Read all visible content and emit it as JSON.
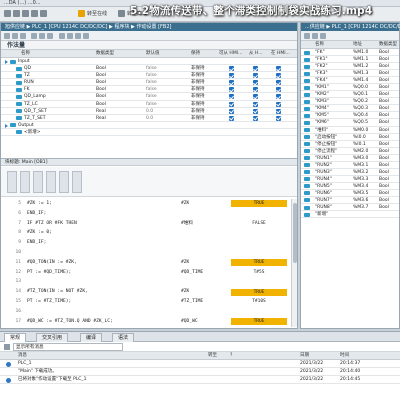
{
  "window": {
    "title_fragment": "...DA (...)  ...0...",
    "video_title": "5.2物流传送带、整个滞类控制制袋实战练习.mp4"
  },
  "toolbar": {
    "items": [
      "转至在线",
      "转至离线",
      "..."
    ]
  },
  "left_breadcrumb": "旭供应链 ▶ PLC_1 [CPU 1214C DC/DC/DC] ▶ 程序块 ▶ 作动设置 [FB2]",
  "right_breadcrumb": "...供应链 ▶ PLC_1 [CPU 1214C DC/DC/DC]",
  "interface": {
    "section_title": "作法量",
    "columns": [
      "名称",
      "数据类型",
      "默认值",
      "保持",
      "可从 HMI...",
      "从 H...",
      "在 HMI..."
    ],
    "rows": [
      {
        "indent": 0,
        "expander": true,
        "name": "Input",
        "type": "",
        "default": "",
        "retain": "",
        "checks": false
      },
      {
        "indent": 1,
        "expander": false,
        "name": "QD",
        "type": "Bool",
        "default": "false",
        "retain": "非保持",
        "checks": true
      },
      {
        "indent": 1,
        "expander": false,
        "name": "TZ",
        "type": "Bool",
        "default": "false",
        "retain": "非保持",
        "checks": true
      },
      {
        "indent": 1,
        "expander": false,
        "name": "RUN",
        "type": "Bool",
        "default": "false",
        "retain": "非保持",
        "checks": true
      },
      {
        "indent": 1,
        "expander": false,
        "name": "FK",
        "type": "Bool",
        "default": "false",
        "retain": "非保持",
        "checks": true
      },
      {
        "indent": 1,
        "expander": false,
        "name": "QD_Lamp",
        "type": "Bool",
        "default": "false",
        "retain": "非保持",
        "checks": true
      },
      {
        "indent": 1,
        "expander": false,
        "name": "TZ_LC",
        "type": "Bool",
        "default": "false",
        "retain": "非保持",
        "checks": true
      },
      {
        "indent": 1,
        "expander": false,
        "name": "QD_T_SET",
        "type": "Real",
        "default": "0.0",
        "retain": "非保持",
        "checks": true
      },
      {
        "indent": 1,
        "expander": false,
        "name": "TZ_T_SET",
        "type": "Real",
        "default": "0.0",
        "retain": "非保持",
        "checks": true
      },
      {
        "indent": 0,
        "expander": true,
        "name": "Output",
        "type": "",
        "default": "",
        "retain": "",
        "checks": false
      },
      {
        "indent": 1,
        "expander": false,
        "name": "<新增>",
        "type": "",
        "default": "",
        "retain": "",
        "checks": false
      }
    ]
  },
  "code_header": "块标题: Main [OB1]",
  "code": {
    "lines": [
      {
        "ln": "5",
        "text": "#ZK := 1;",
        "mon_name": "#ZK",
        "mon_val": "TRUE",
        "state": "true"
      },
      {
        "ln": "6",
        "text": "END_IF;",
        "mon_name": "",
        "mon_val": "",
        "state": ""
      },
      {
        "ln": "7",
        "text": "IF #TZ OR #FK THEN",
        "mon_name": "#堆料",
        "mon_val": "FALSE",
        "state": "false"
      },
      {
        "ln": "8",
        "text": "    #ZK := 0;",
        "mon_name": "",
        "mon_val": "",
        "state": ""
      },
      {
        "ln": "9",
        "text": "END_IF;",
        "mon_name": "",
        "mon_val": "",
        "state": ""
      },
      {
        "ln": "10",
        "text": "",
        "mon_name": "",
        "mon_val": "",
        "state": ""
      },
      {
        "ln": "11",
        "text": "#QD_TON(IN := #ZK,",
        "mon_name": "#ZK",
        "mon_val": "TRUE",
        "state": "true"
      },
      {
        "ln": "12",
        "text": "        PT := #QD_TIME);",
        "mon_name": "#QD_TIME",
        "mon_val": "T#5S",
        "state": "false"
      },
      {
        "ln": "13",
        "text": "",
        "mon_name": "",
        "mon_val": "",
        "state": ""
      },
      {
        "ln": "14",
        "text": "#TZ_TON(IN := NOT #ZK,",
        "mon_name": "#ZK",
        "mon_val": "TRUE",
        "state": "true"
      },
      {
        "ln": "15",
        "text": "        PT := #TZ_TIME);",
        "mon_name": "#TZ_TIME",
        "mon_val": "T#10S",
        "state": "false"
      },
      {
        "ln": "16",
        "text": "",
        "mon_name": "",
        "mon_val": "",
        "state": ""
      },
      {
        "ln": "17",
        "text": "#QD_WC := #TZ_TON.Q AND #ZK_LC;",
        "mon_name": "#QD_WC",
        "mon_val": "TRUE",
        "state": "true"
      },
      {
        "ln": "18",
        "text": "#TZ_WC := #TZ_TON.Q AND #TZ_LC;",
        "mon_name": "#TZ_WC",
        "mon_val": "FALSE",
        "state": "false"
      },
      {
        "ln": "19",
        "text": "",
        "mon_name": "",
        "mon_val": "",
        "state": ""
      },
      {
        "ln": "20",
        "text": "",
        "mon_name": "",
        "mon_val": "",
        "state": ""
      }
    ]
  },
  "tag_table": {
    "columns": [
      "名称",
      "地址",
      "数据类型",
      "注释"
    ],
    "rows": [
      {
        "name": "\"FK\"",
        "addr": "%M1.0",
        "type": "Bool"
      },
      {
        "name": "\"FK1\"",
        "addr": "%M1.1",
        "type": "Bool"
      },
      {
        "name": "\"FK2\"",
        "addr": "%M1.2",
        "type": "Bool"
      },
      {
        "name": "\"FK3\"",
        "addr": "%M1.3",
        "type": "Bool"
      },
      {
        "name": "\"FK4\"",
        "addr": "%M1.4",
        "type": "Bool"
      },
      {
        "name": "\"KM1\"",
        "addr": "%Q0.0",
        "type": "Bool"
      },
      {
        "name": "\"KM2\"",
        "addr": "%Q0.1",
        "type": "Bool"
      },
      {
        "name": "\"KM3\"",
        "addr": "%Q0.2",
        "type": "Bool"
      },
      {
        "name": "\"KM4\"",
        "addr": "%Q0.3",
        "type": "Bool"
      },
      {
        "name": "\"KM5\"",
        "addr": "%Q0.4",
        "type": "Bool"
      },
      {
        "name": "\"KM6\"",
        "addr": "%Q0.5",
        "type": "Bool"
      },
      {
        "name": "\"堆料\"",
        "addr": "%M0.0",
        "type": "Bool"
      },
      {
        "name": "\"启动按钮\"",
        "addr": "%I0.0",
        "type": "Bool"
      },
      {
        "name": "\"停止按钮\"",
        "addr": "%I0.1",
        "type": "Bool"
      },
      {
        "name": "\"停止流程\"",
        "addr": "%M2.0",
        "type": "Bool"
      },
      {
        "name": "\"RUN1\"",
        "addr": "%M3.0",
        "type": "Bool"
      },
      {
        "name": "\"RUN2\"",
        "addr": "%M3.1",
        "type": "Bool"
      },
      {
        "name": "\"RUN3\"",
        "addr": "%M3.2",
        "type": "Bool"
      },
      {
        "name": "\"RUN4\"",
        "addr": "%M3.3",
        "type": "Bool"
      },
      {
        "name": "\"RUN5\"",
        "addr": "%M3.4",
        "type": "Bool"
      },
      {
        "name": "\"RUN6\"",
        "addr": "%M3.5",
        "type": "Bool"
      },
      {
        "name": "\"RUN7\"",
        "addr": "%M3.6",
        "type": "Bool"
      },
      {
        "name": "\"RUN8\"",
        "addr": "%M3.7",
        "type": "Bool"
      },
      {
        "name": "\"新增\"",
        "addr": "",
        "type": ""
      }
    ]
  },
  "inspector": {
    "tabs": [
      "常规",
      "交叉引用",
      "编译",
      "语法"
    ],
    "filter_label": "显示所有消息",
    "columns": [
      "消息",
      "转至",
      "?",
      "日期",
      "时间"
    ],
    "rows": [
      {
        "icon": true,
        "msg": "PLC_1",
        "date": "2021/3/22",
        "time": "20:14:37"
      },
      {
        "icon": false,
        "msg": "    \"Main\" 下载成功。",
        "date": "2021/3/22",
        "time": "20:14:40"
      },
      {
        "icon": true,
        "msg": "已将对象\"作动设置\"下载至 PLC_1",
        "date": "2021/3/22",
        "time": "20:14:45"
      }
    ]
  },
  "colors": {
    "accent": "#3a6f8f",
    "true_bg": "#f1b300",
    "check": "#1f6fc2"
  }
}
